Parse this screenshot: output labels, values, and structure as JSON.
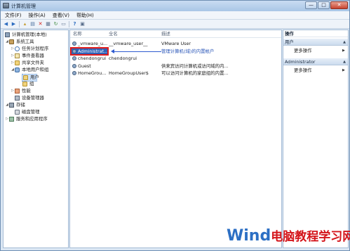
{
  "window": {
    "title": "计算机管理",
    "controls": {
      "minimize": "—",
      "maximize": "□",
      "close": "✕"
    }
  },
  "menu": [
    "文件(F)",
    "操作(A)",
    "查看(V)",
    "帮助(H)"
  ],
  "toolbar_icons": [
    "back-icon",
    "forward-icon",
    "up-icon",
    "show-tree-icon",
    "delete-icon",
    "properties-icon",
    "refresh-icon",
    "export-icon",
    "help-icon",
    "console-icon"
  ],
  "tree": {
    "root": "计算机管理(本地)",
    "system_tools": "系统工具",
    "task_scheduler": "任务计划程序",
    "event_viewer": "事件查看器",
    "shared_folders": "共享文件夹",
    "local_users_groups": "本地用户和组",
    "users": "用户",
    "groups": "组",
    "performance": "性能",
    "device_manager": "设备管理器",
    "storage": "存储",
    "disk_management": "磁盘管理",
    "services_apps": "服务和应用程序"
  },
  "list": {
    "columns": {
      "name": "名称",
      "fullname": "全名",
      "description": "描述"
    },
    "rows": [
      {
        "name": "_vmware_u...",
        "fullname": "__vmware_user__",
        "description": "VMware User"
      },
      {
        "name": "Administrat...",
        "fullname": "",
        "description": "管理计算机(域)的内置帐户"
      },
      {
        "name": "chendongrui",
        "fullname": "chendongrui",
        "description": ""
      },
      {
        "name": "Guest",
        "fullname": "",
        "description": "供来宾访问计算机或访问域的内..."
      },
      {
        "name": "HomeGrou...",
        "fullname": "HomeGroupUser$",
        "description": "可以访问计算机的家庭组的内置..."
      }
    ]
  },
  "actions": {
    "title": "操作",
    "section_users": "用户",
    "more_actions_1": "更多操作",
    "section_admin": "Administrator",
    "more_actions_2": "更多操作"
  },
  "watermark": {
    "faint_text": "Windows",
    "brand_part1": "Wind",
    "brand_part2": "电脑教程学习网"
  },
  "colors": {
    "selection": "#2f62b7",
    "highlight_box": "#e01c1c",
    "annotation_arrow": "#2f5bd0",
    "brand_blue": "#2c6fc4",
    "brand_red": "#d4151b"
  }
}
